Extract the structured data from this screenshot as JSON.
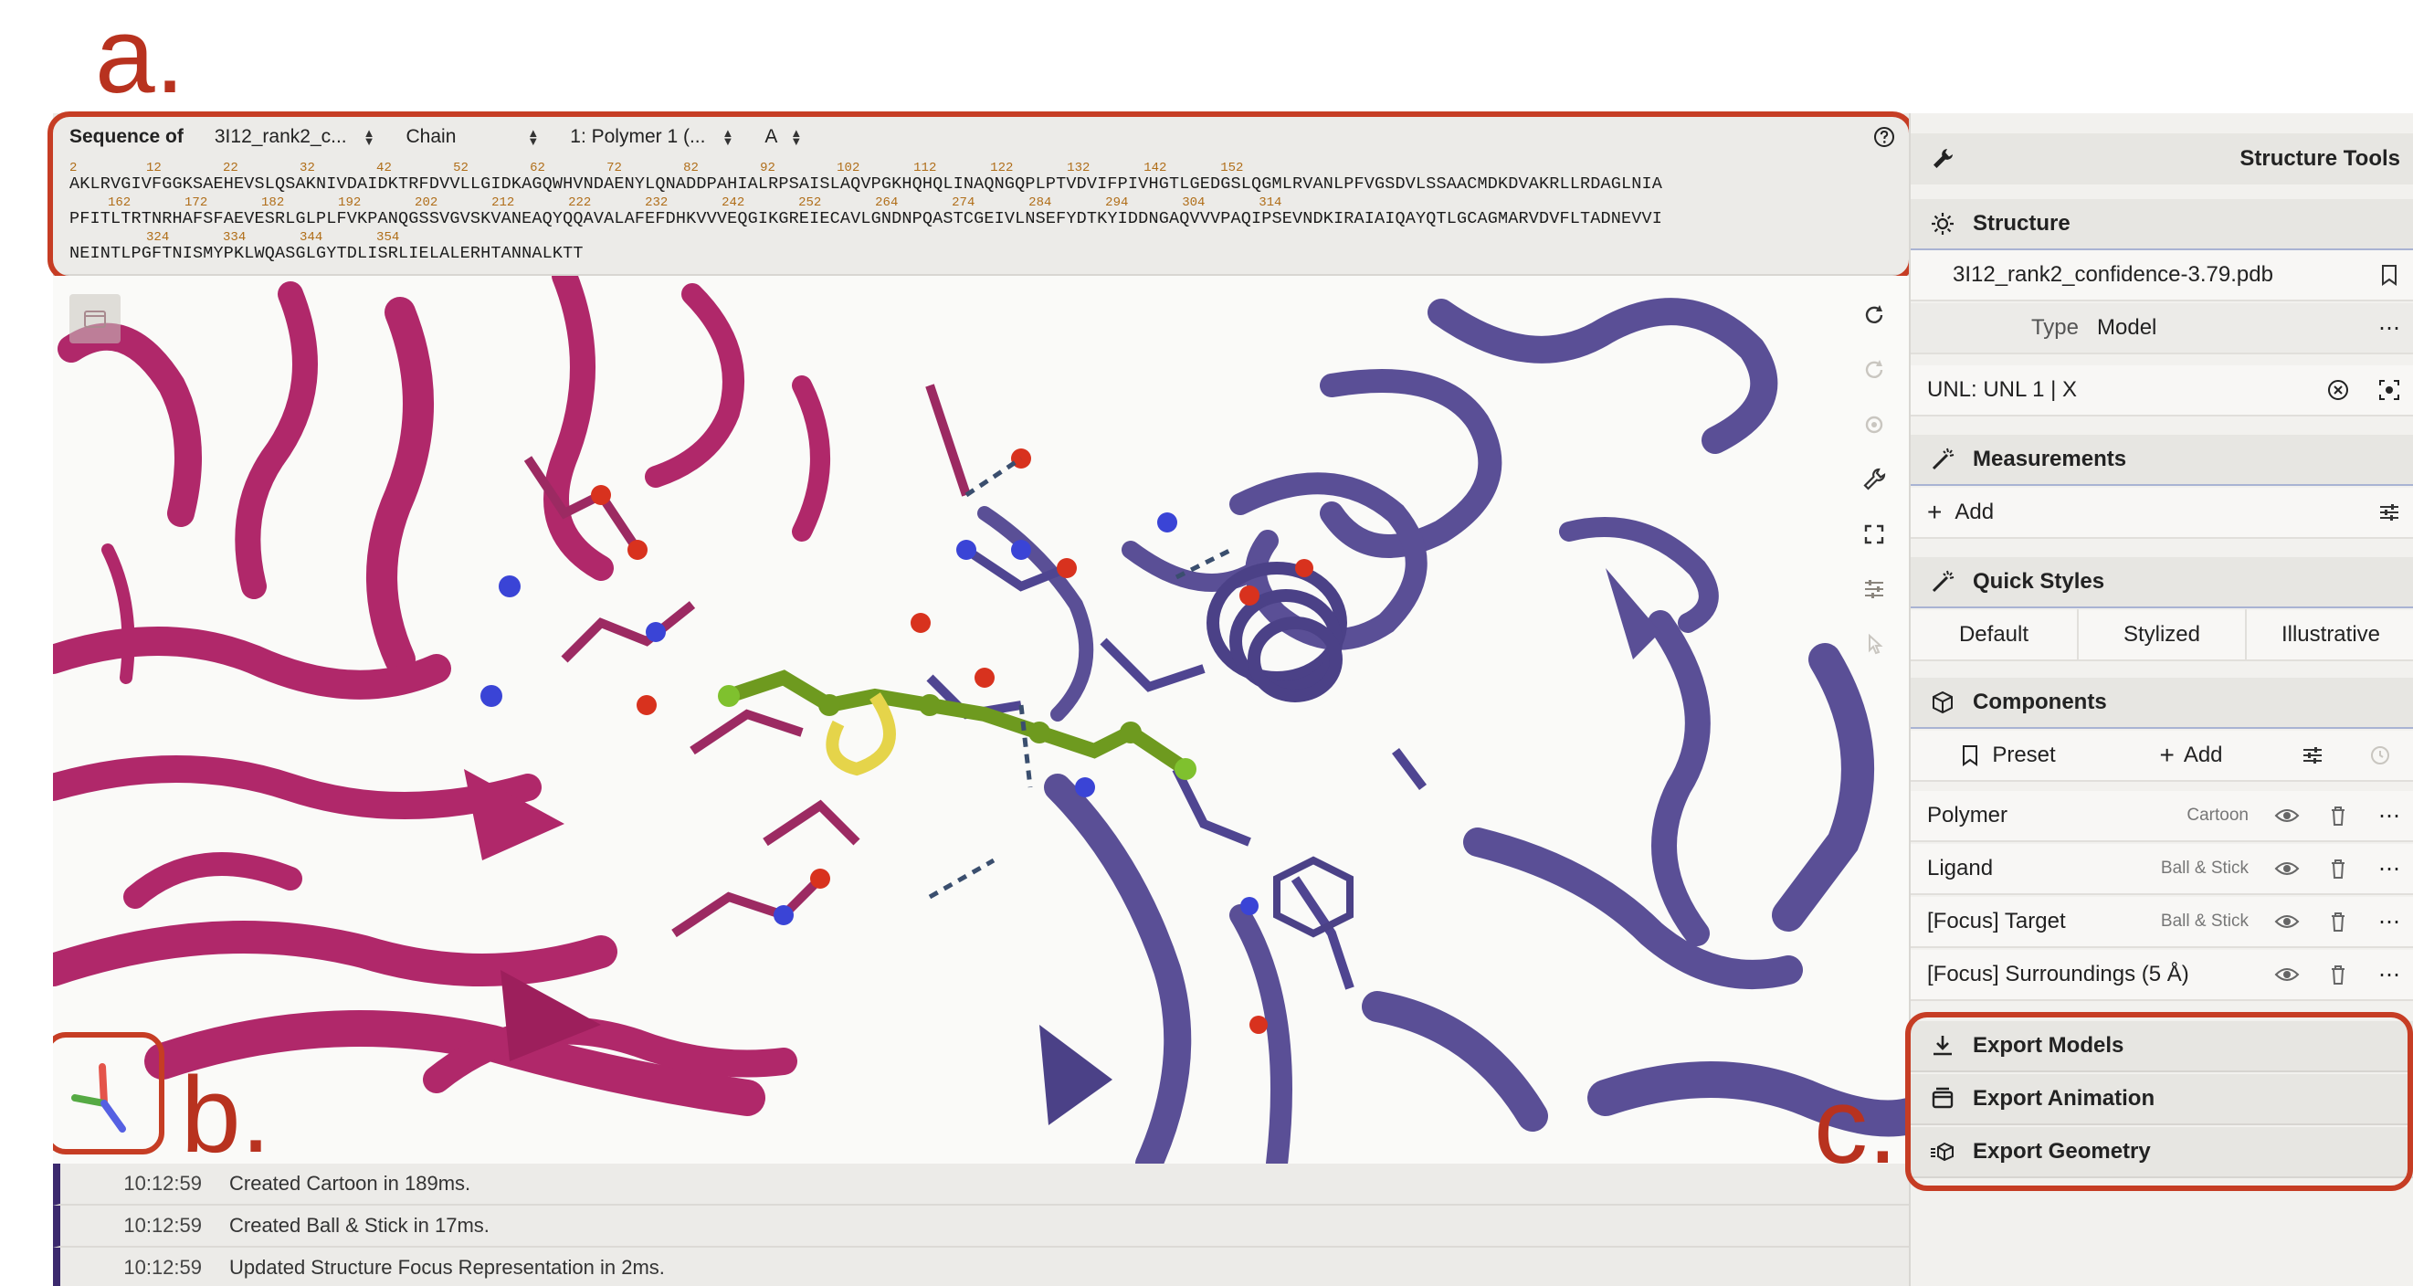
{
  "annotations": {
    "a": "a.",
    "b": "b.",
    "c": "c."
  },
  "sequence": {
    "label": "Sequence of",
    "structure_select": "3I12_rank2_c...",
    "mode_select": "Chain",
    "entity_select": "1: Polymer 1 (...",
    "chain_select": "A",
    "help_icon": "help-circle-icon",
    "lines": [
      {
        "nums": "2         12        22        32        42        52        62        72        82        92        102       112       122       132       142       152",
        "seq": "AKLRVGIVFGGKSAEHEVSLQSAKNIVDAIDKTRFDVVLLGIDKAGQWHVNDAENYLQNADDPAHIALRPSAISLAQVPGKHQHQLINAQNGQPLPTVDVIFPIVHGTLGEDGSLQGMLRVANLPFVGSDVLSSAACMDKDVAKRLLRDAGLNIA"
      },
      {
        "nums": "     162       172       182       192       202       212       222       232       242       252       264       274       284       294       304       314",
        "seq": "PFITLTRTNRHAFSFAEVESRLGLPLFVKPANQGSSVGVSKVANEAQYQQAVALAFEFDHKVVVEQGIKGREIECAVLGNDNPQASTCGEIVLNSEFYDTKYIDDNGAQVVVPAQIPSEVNDKIRAIAIQAYQTLGCAGMARVDVFLTADNEVVI"
      },
      {
        "nums": "          324       334       344       354",
        "seq": "NEINTLPGFTNISMYPKLWQASGLGYTDLISRLIELALERHTANNALKTT"
      }
    ]
  },
  "viewer": {
    "tools": [
      "reset-view-icon",
      "spin-icon",
      "animation-icon",
      "wrench-icon",
      "expand-icon",
      "sliders-icon",
      "selection-icon"
    ],
    "toggle_icon": "viewport-toggle-icon",
    "axes_icon": "axes-icon",
    "colors": {
      "polymer_a": "#b0286a",
      "polymer_b": "#5a4f96",
      "ligand": "#6e9a1f",
      "oxygen": "#d8321e",
      "nitrogen": "#3a44d6",
      "sulfur": "#e5d44a"
    }
  },
  "log": [
    {
      "time": "10:12:59",
      "message": "Created Cartoon in 189ms."
    },
    {
      "time": "10:12:59",
      "message": "Created Ball & Stick in 17ms."
    },
    {
      "time": "10:12:59",
      "message": "Updated Structure Focus Representation in 2ms."
    }
  ],
  "panel": {
    "title": "Structure Tools",
    "structure": {
      "header": "Structure",
      "file": "3I12_rank2_confidence-3.79.pdb",
      "type_label": "Type",
      "type_value": "Model",
      "selection": "UNL: UNL 1 | X"
    },
    "measurements": {
      "header": "Measurements",
      "add": "Add"
    },
    "quick_styles": {
      "header": "Quick Styles",
      "options": [
        "Default",
        "Stylized",
        "Illustrative"
      ]
    },
    "components": {
      "header": "Components",
      "preset": "Preset",
      "add": "Add",
      "items": [
        {
          "name": "Polymer",
          "style": "Cartoon"
        },
        {
          "name": "Ligand",
          "style": "Ball & Stick"
        },
        {
          "name": "[Focus] Target",
          "style": "Ball & Stick"
        },
        {
          "name": "[Focus] Surroundings (5 Å)",
          "style": ""
        }
      ]
    },
    "export": [
      "Export Models",
      "Export Animation",
      "Export Geometry"
    ]
  }
}
